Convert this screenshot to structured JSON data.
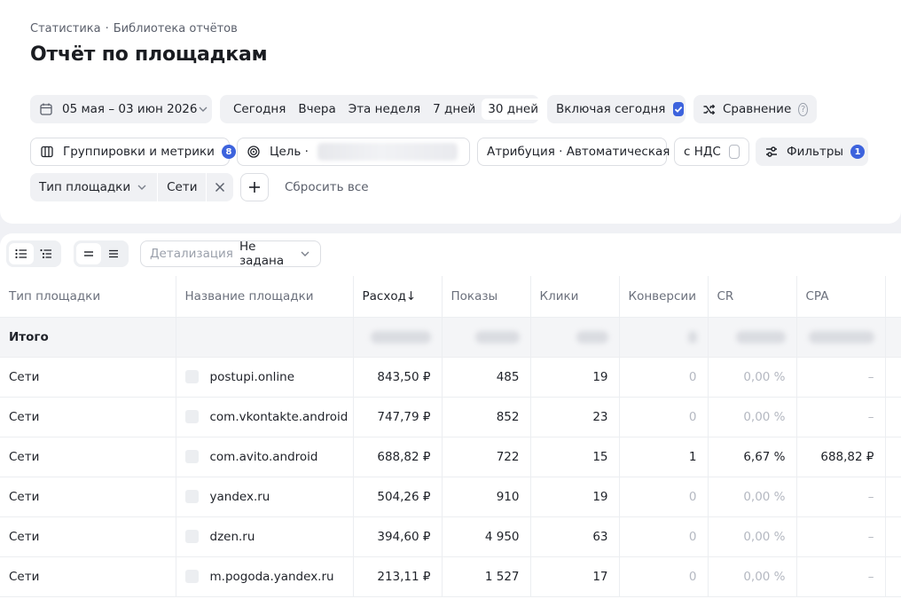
{
  "breadcrumb": {
    "item1": "Статистика",
    "separator": "·",
    "item2": "Библиотека отчётов"
  },
  "page_title": "Отчёт по площадкам",
  "date_range": "05 мая – 03 июн 2026",
  "periods": [
    "Сегодня",
    "Вчера",
    "Эта неделя",
    "7 дней",
    "30 дней"
  ],
  "active_period": "30 дней",
  "include_today": {
    "label": "Включая сегодня",
    "checked": true
  },
  "comparison": {
    "label": "Сравнение",
    "help": "?"
  },
  "groupings": {
    "label": "Группировки и метрики",
    "count": "8"
  },
  "goal": {
    "label": "Цель ·"
  },
  "attribution": "Атрибуция · Автоматическая",
  "vat": {
    "label": "с НДС",
    "checked": false
  },
  "filters": {
    "label": "Фильтры",
    "count": "1"
  },
  "active_filter": {
    "field": "Тип площадки",
    "value": "Сети"
  },
  "reset_label": "Сбросить все",
  "detail": {
    "label": "Детализация",
    "value": "Не задана"
  },
  "table": {
    "headers": [
      "Тип площадки",
      "Название площадки",
      "Расход",
      "Показы",
      "Клики",
      "Конверсии",
      "CR",
      "CPA"
    ],
    "sort_arrow": "↓",
    "total_label": "Итого",
    "rows": [
      {
        "type": "Сети",
        "name": "postupi.online",
        "spend": "843,50 ₽",
        "shows": "485",
        "clicks": "19",
        "conv": "0",
        "cr": "0,00 %",
        "cpa": "–"
      },
      {
        "type": "Сети",
        "name": "com.vkontakte.android",
        "spend": "747,79 ₽",
        "shows": "852",
        "clicks": "23",
        "conv": "0",
        "cr": "0,00 %",
        "cpa": "–"
      },
      {
        "type": "Сети",
        "name": "com.avito.android",
        "spend": "688,82 ₽",
        "shows": "722",
        "clicks": "15",
        "conv": "1",
        "cr": "6,67 %",
        "cpa": "688,82 ₽"
      },
      {
        "type": "Сети",
        "name": "yandex.ru",
        "spend": "504,26 ₽",
        "shows": "910",
        "clicks": "19",
        "conv": "0",
        "cr": "0,00 %",
        "cpa": "–"
      },
      {
        "type": "Сети",
        "name": "dzen.ru",
        "spend": "394,60 ₽",
        "shows": "4 950",
        "clicks": "63",
        "conv": "0",
        "cr": "0,00 %",
        "cpa": "–"
      },
      {
        "type": "Сети",
        "name": "m.pogoda.yandex.ru",
        "spend": "213,11 ₽",
        "shows": "1 527",
        "clicks": "17",
        "conv": "0",
        "cr": "0,00 %",
        "cpa": "–"
      }
    ]
  },
  "colors": {
    "accent": "#3d63dd",
    "chip_bg": "#f0f1f4",
    "page_bg": "#f0f1f5"
  },
  "icons": [
    "calendar-icon",
    "chevron-down-icon",
    "check-icon",
    "shuffle-icon",
    "help-icon",
    "columns-icon",
    "target-icon",
    "sliders-icon",
    "close-icon",
    "plus-icon",
    "list-icon",
    "numbered-list-icon",
    "density-compact-icon",
    "density-normal-icon"
  ]
}
